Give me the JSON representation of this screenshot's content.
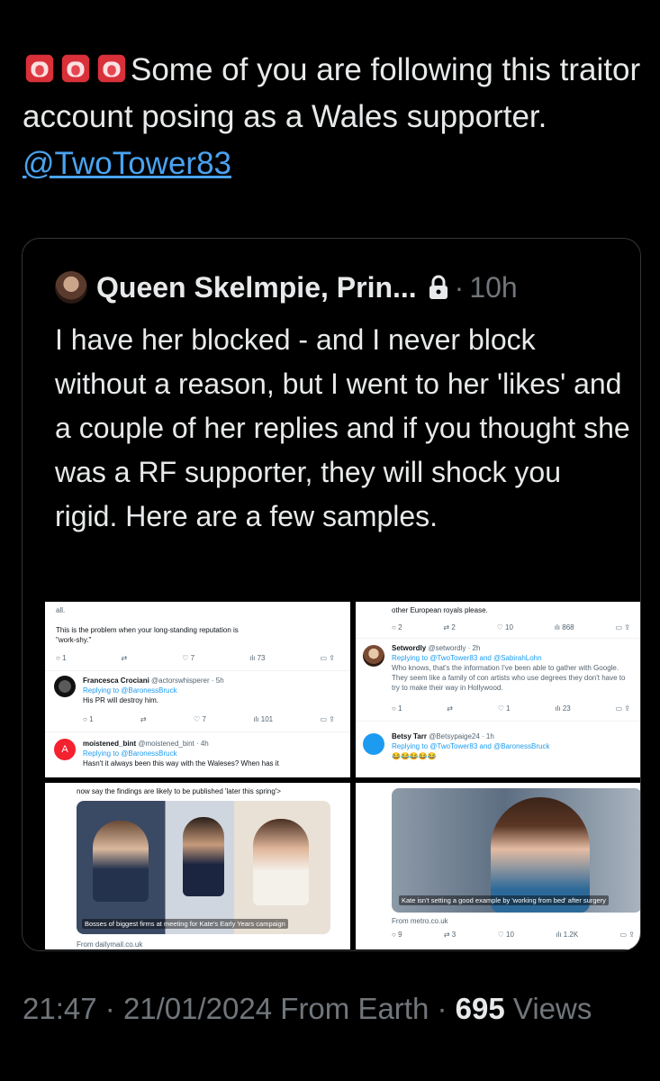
{
  "tweet": {
    "text": "Some of you are following this traitor account posing as a Wales supporter.",
    "mention": "@TwoTower83",
    "emoji": [
      "siren-icon",
      "siren-icon",
      "siren-icon"
    ]
  },
  "quote": {
    "name": "Queen Skelmpie, Prin...",
    "separator": "·",
    "time": "10h",
    "body": "I have her blocked - and I never block without a reason, but I went to her 'likes' and a couple of her replies and if you thought she was a RF supporter, they will shock you rigid. Here are a few samples."
  },
  "collage": {
    "top_left": {
      "top_line": "all.",
      "para1": "This is the problem when your long-standing reputation is",
      "para2": "\"work-shy.\"",
      "row1": {
        "reply": "1",
        "like": "7",
        "views": "73"
      },
      "reply1": {
        "name": "Francesca Crociani",
        "handle": "@actorswhisperer · 5h",
        "replying": "Replying to @BaronessBruck",
        "text": "His PR will destroy him."
      },
      "row2": {
        "reply": "1",
        "like": "7",
        "views": "101"
      },
      "reply2": {
        "initial": "A",
        "name": "moistened_bint",
        "handle": "@moistened_bint · 4h",
        "replying": "Replying to @BaronessBruck",
        "text": "Hasn't it always been this way with the Waleses? When has it"
      }
    },
    "top_right": {
      "top_line": "other European royals please.",
      "row1": {
        "reply": "2",
        "retweet": "2",
        "like": "10",
        "views": "868"
      },
      "reply1": {
        "name": "Setwordly",
        "handle": "@setwordly · 2h",
        "replying": "Replying to @TwoTower83 and @SabirahLohn",
        "text": "Who knows, that's the information I've been able to gather with Google. They seem like a family of con artists who use degrees they don't have to try to make their way in Hollywood."
      },
      "row2": {
        "reply": "1",
        "like": "1",
        "views": "23"
      },
      "reply2": {
        "name": "Betsy Tarr",
        "handle": "@Betsypaige24 · 1h",
        "replying": "Replying to @TwoTower83 and @BaronessBruck",
        "text": "😂😂😂😂😂"
      }
    },
    "bottom_left": {
      "top_line": "now say the findings are likely to be published 'later this spring'>",
      "caption": "Bosses of biggest firms at meeting for Kate's Early Years campaign",
      "source": "From dailymail.co.uk"
    },
    "bottom_right": {
      "caption": "Kate isn't setting a good example by 'working from bed' after surgery",
      "source": "From metro.co.uk",
      "row": {
        "reply": "9",
        "retweet": "3",
        "like": "10",
        "views": "1.2K"
      }
    }
  },
  "footer": {
    "time": "21:47",
    "sep1": "·",
    "date": "21/01/2024",
    "source": "From Earth",
    "sep2": "·",
    "views_count": "695",
    "views_label": "Views"
  },
  "colors": {
    "background": "#000000",
    "text": "#e7e9ea",
    "muted": "#71767b",
    "link": "#4aa3f0",
    "border": "#333639"
  }
}
